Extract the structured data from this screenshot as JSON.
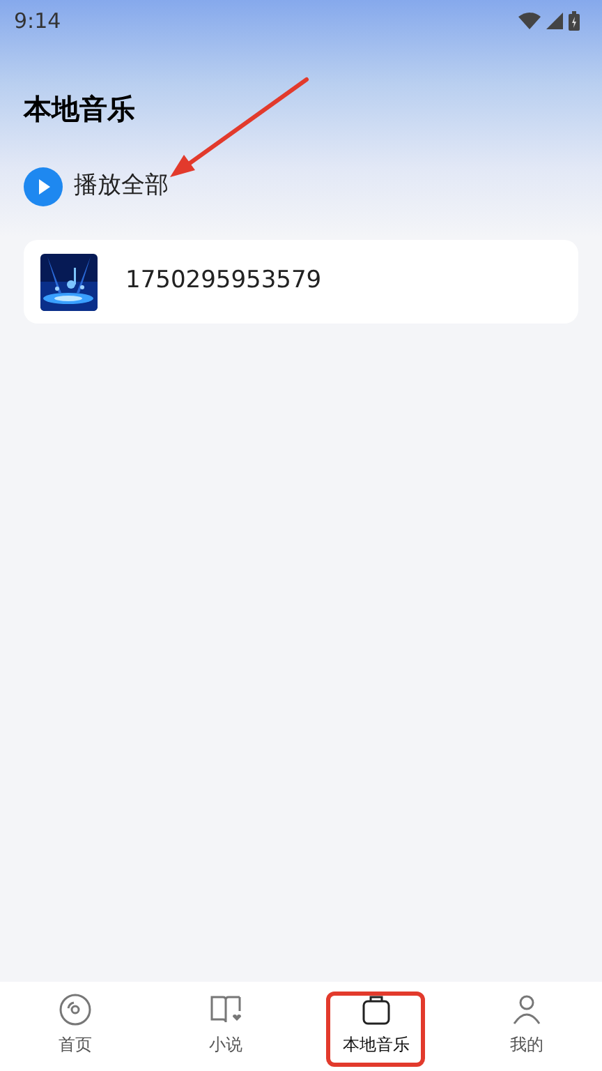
{
  "status_bar": {
    "time": "9:14"
  },
  "title": "本地音乐",
  "play_all": {
    "label": "播放全部"
  },
  "songs": [
    {
      "name": "1750295953579"
    }
  ],
  "tabs": [
    {
      "label": "首页",
      "kind": "disc",
      "selected": false
    },
    {
      "label": "小说",
      "kind": "book",
      "selected": false
    },
    {
      "label": "本地音乐",
      "kind": "bag",
      "selected": true
    },
    {
      "label": "我的",
      "kind": "person",
      "selected": false
    }
  ]
}
